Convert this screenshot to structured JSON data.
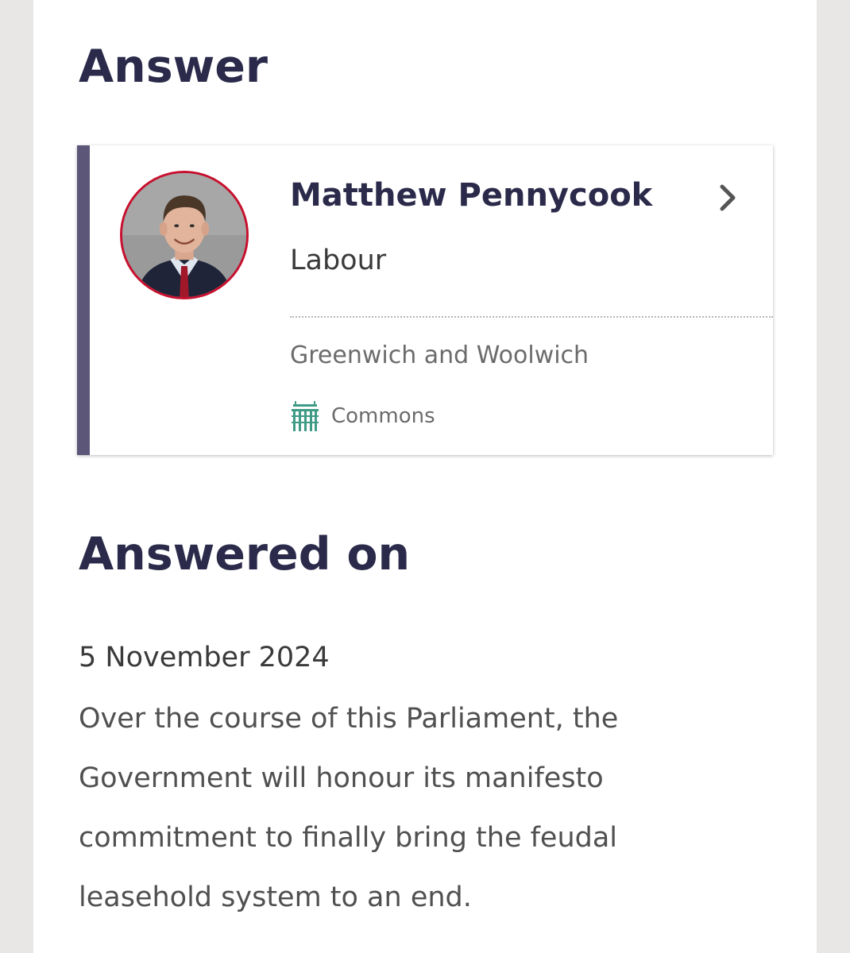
{
  "answer_section": {
    "heading": "Answer"
  },
  "member": {
    "name": "Matthew Pennycook",
    "party": "Labour",
    "constituency": "Greenwich and Woolwich",
    "house": "Commons",
    "house_icon": "portcullis-icon",
    "chevron_icon": "chevron-right-icon",
    "party_color": "#c8102e",
    "accent_color": "#5c5679",
    "house_color": "#3f9b85"
  },
  "answered_section": {
    "heading": "Answered on",
    "date": "5 November 2024",
    "text": "Over the course of this Parliament, the Government will honour its manifesto commitment to finally bring the feudal leasehold system to an end."
  }
}
